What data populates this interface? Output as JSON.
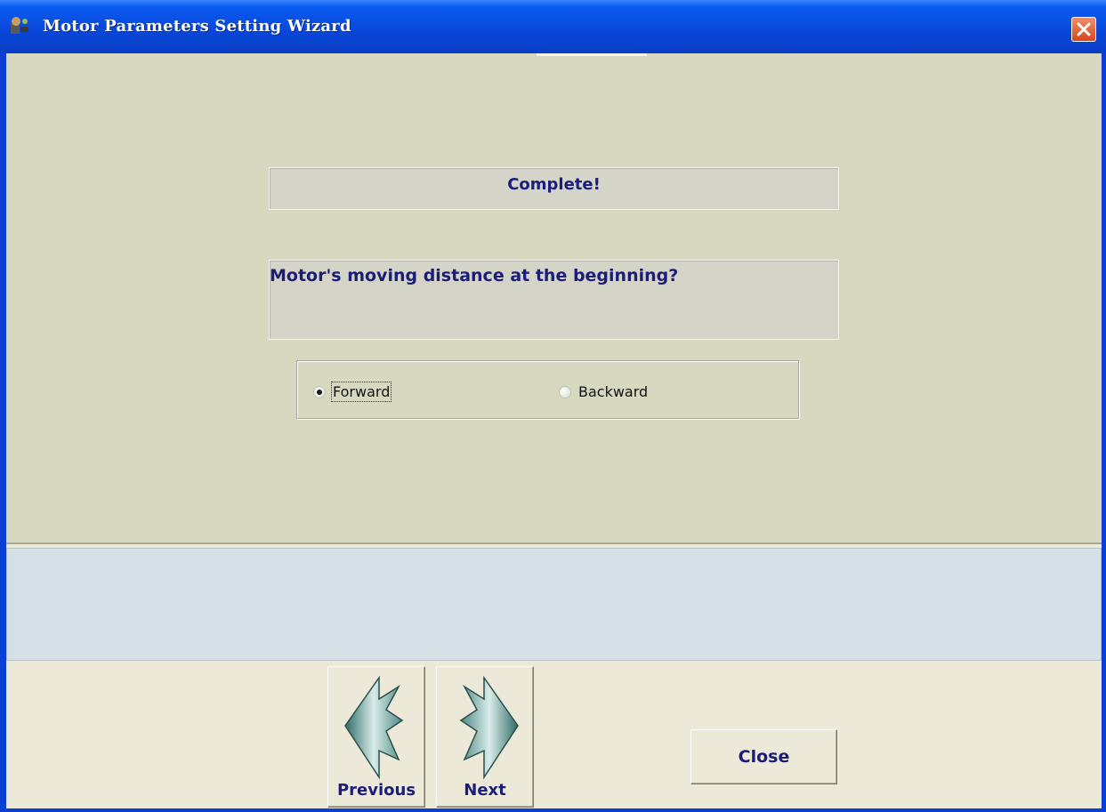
{
  "window": {
    "title": "Motor Parameters Setting Wizard"
  },
  "main": {
    "status_label": "Complete!",
    "question": "Motor's moving distance at the beginning?",
    "direction_options": [
      {
        "label": "Forward",
        "selected": true
      },
      {
        "label": "Backward",
        "selected": false
      }
    ]
  },
  "status_panel": {
    "text": ""
  },
  "buttons": {
    "previous_label": "Previous",
    "next_label": "Next",
    "close_label": "Close"
  },
  "icons": {
    "app": "motor-app-icon",
    "close": "close-icon",
    "previous": "left-arrow-icon",
    "next": "right-arrow-icon"
  },
  "colors": {
    "titlebar": "#0846d8",
    "panel": "#d8d8c0",
    "text_accent": "#1c1c7a",
    "status_panel": "#d4dfe6",
    "close_button": "#d8461c"
  }
}
